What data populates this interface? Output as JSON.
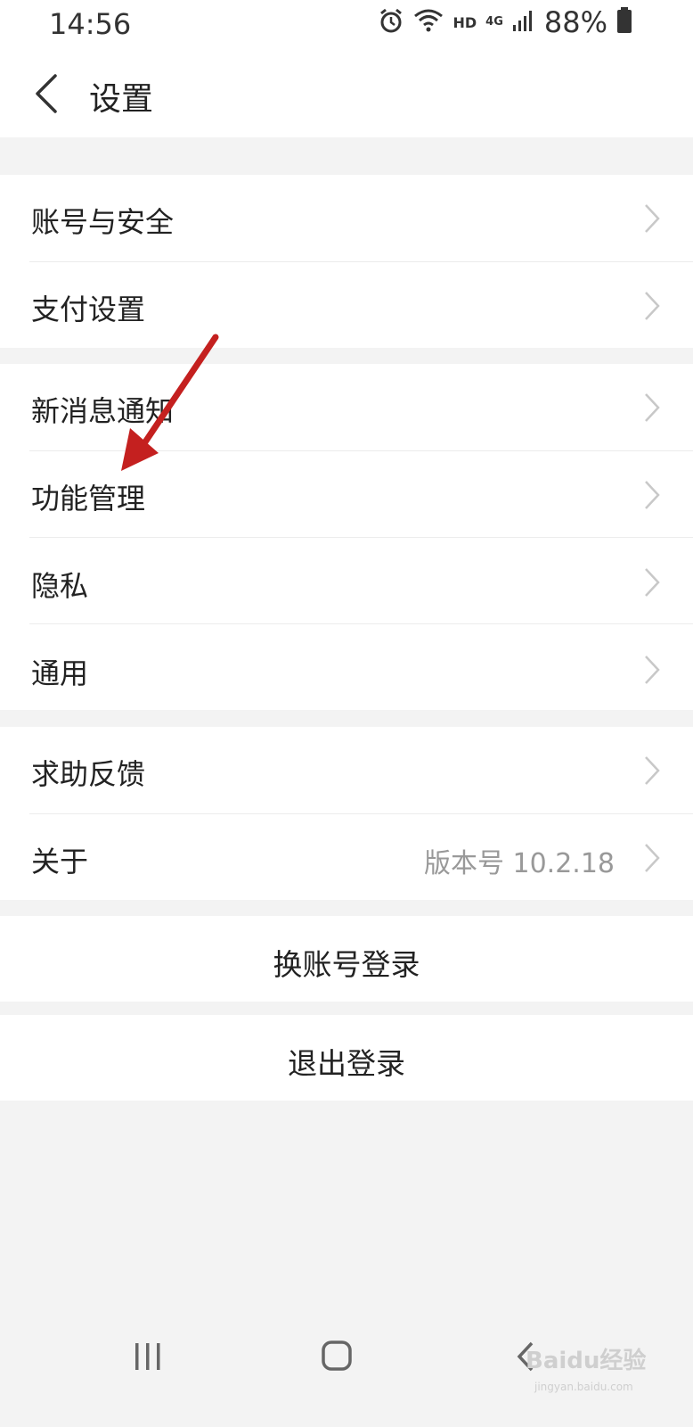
{
  "status": {
    "time": "14:56",
    "hd": "HD",
    "network": "4G",
    "battery": "88%",
    "icons": [
      "alarm-icon",
      "wifi-icon",
      "signal-icon",
      "battery-icon"
    ]
  },
  "header": {
    "title": "设置"
  },
  "groups": [
    {
      "items": [
        {
          "label": "账号与安全"
        },
        {
          "label": "支付设置"
        }
      ]
    },
    {
      "items": [
        {
          "label": "新消息通知"
        },
        {
          "label": "功能管理"
        },
        {
          "label": "隐私"
        },
        {
          "label": "通用"
        }
      ]
    },
    {
      "items": [
        {
          "label": "求助反馈"
        },
        {
          "label": "关于",
          "value": "版本号 10.2.18"
        }
      ]
    }
  ],
  "actions": {
    "switch_account": "换账号登录",
    "logout": "退出登录"
  },
  "watermark": {
    "main": "Baidu经验",
    "sub": "jingyan.baidu.com"
  },
  "colors": {
    "annotation_arrow": "#c4201f",
    "background": "#f3f3f3",
    "secondary_text": "#999999"
  }
}
